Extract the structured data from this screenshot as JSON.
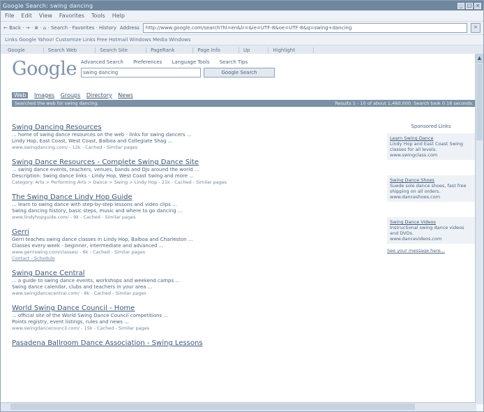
{
  "window": {
    "title": "Google Search: swing dancing",
    "btn_min": "_",
    "btn_max": "□",
    "btn_close": "×"
  },
  "menu": [
    "File",
    "Edit",
    "View",
    "Favorites",
    "Tools",
    "Help"
  ],
  "address": {
    "nav_label": "← Back · → · ⊗ · ⌂ · Search · Favorites · History",
    "label": "Address",
    "url": "http://www.google.com/search?hl=en&lr=&ie=UTF-8&oe=UTF-8&q=swing+dancing",
    "go": "»"
  },
  "links_bar": "Links   Google   Yahoo!   Customize Links   Free Hotmail   Windows Media   Windows",
  "google_toolbar": [
    "Google",
    "Search Web",
    "Search Site",
    "PageRank",
    "Page Info",
    "Up",
    "Highlight"
  ],
  "google": {
    "logo": "Google",
    "tabs": [
      "Advanced Search",
      "Preferences",
      "Language Tools",
      "Search Tips"
    ],
    "query": "swing dancing",
    "search_button": "Google Search"
  },
  "subtabs": {
    "active": "Web",
    "items": [
      "Images",
      "Groups",
      "Directory",
      "News"
    ]
  },
  "stats": {
    "left": "Searched the web for swing dancing.",
    "right": "Results 1 - 10 of about 1,460,000. Search took 0.18 seconds."
  },
  "results": [
    {
      "title": "Swing Dancing Resources",
      "snippet": "... home of swing dance resources on the web - links for swing dancers ...",
      "snippet2": "Lindy Hop, East Coast, West Coast, Balboa and Collegiate Shag ...",
      "url": "www.swingdancing.com/ - 12k - Cached - Similar pages"
    },
    {
      "title": "Swing Dance Resources - Complete Swing Dance Site",
      "snippet": "... swing dance events, teachers, venues, bands and DJs around the world ...",
      "snippet2": "Description: Swing dance links - Lindy Hop, West Coast Swing and more ...",
      "url": "Category: Arts > Performing Arts > Dance > Swing > Lindy Hop - 21k - Cached - Similar pages"
    },
    {
      "title": "The Swing Dance Lindy Hop Guide",
      "snippet": "... learn to swing dance with step-by-step lessons and video clips ...",
      "snippet2": "Swing dancing history, basic steps, music and where to go dancing ...",
      "url": "www.lindyhopguide.com/ - 9k - Cached - Similar pages"
    },
    {
      "title": "Gerri",
      "snippet": "Gerri teaches swing dance classes in Lindy Hop, Balboa and Charleston ...",
      "snippet2": "Classes every week - beginner, intermediate and advanced ...",
      "url": "www.gerriswing.com/classes/ - 6k - Cached - Similar pages",
      "extra": "Contact - Schedule"
    },
    {
      "title": "Swing Dance Central",
      "snippet": "... a guide to swing dance events, workshops and weekend camps ...",
      "snippet2": "Swing dance calendar, clubs and teachers in your area ...",
      "url": "www.swingdancecentral.com/ - 8k - Cached - Similar pages"
    },
    {
      "title": "World Swing Dance Council - Home",
      "snippet": "... official site of the World Swing Dance Council competitions ...",
      "snippet2": "Points registry, event listings, rules and news ...",
      "url": "www.swingdancecouncil.com/ - 15k - Cached - Similar pages"
    },
    {
      "title": "Pasadena Ballroom Dance Association - Swing Lessons",
      "snippet": "",
      "snippet2": "",
      "url": ""
    }
  ],
  "sponsored": {
    "heading": "Sponsored Links",
    "ads": [
      {
        "title": "Learn Swing Dance",
        "text": "Lindy Hop and East Coast Swing classes for all levels.",
        "url": "www.swingclass.com"
      },
      {
        "title": "Swing Dance Shoes",
        "text": "Suede sole dance shoes, fast free shipping on all orders.",
        "url": "www.danceshoes.com"
      },
      {
        "title": "Swing Dance Videos",
        "text": "Instructional swing dance videos and DVDs.",
        "url": "www.dancevideos.com"
      }
    ],
    "more": "See your message here..."
  }
}
